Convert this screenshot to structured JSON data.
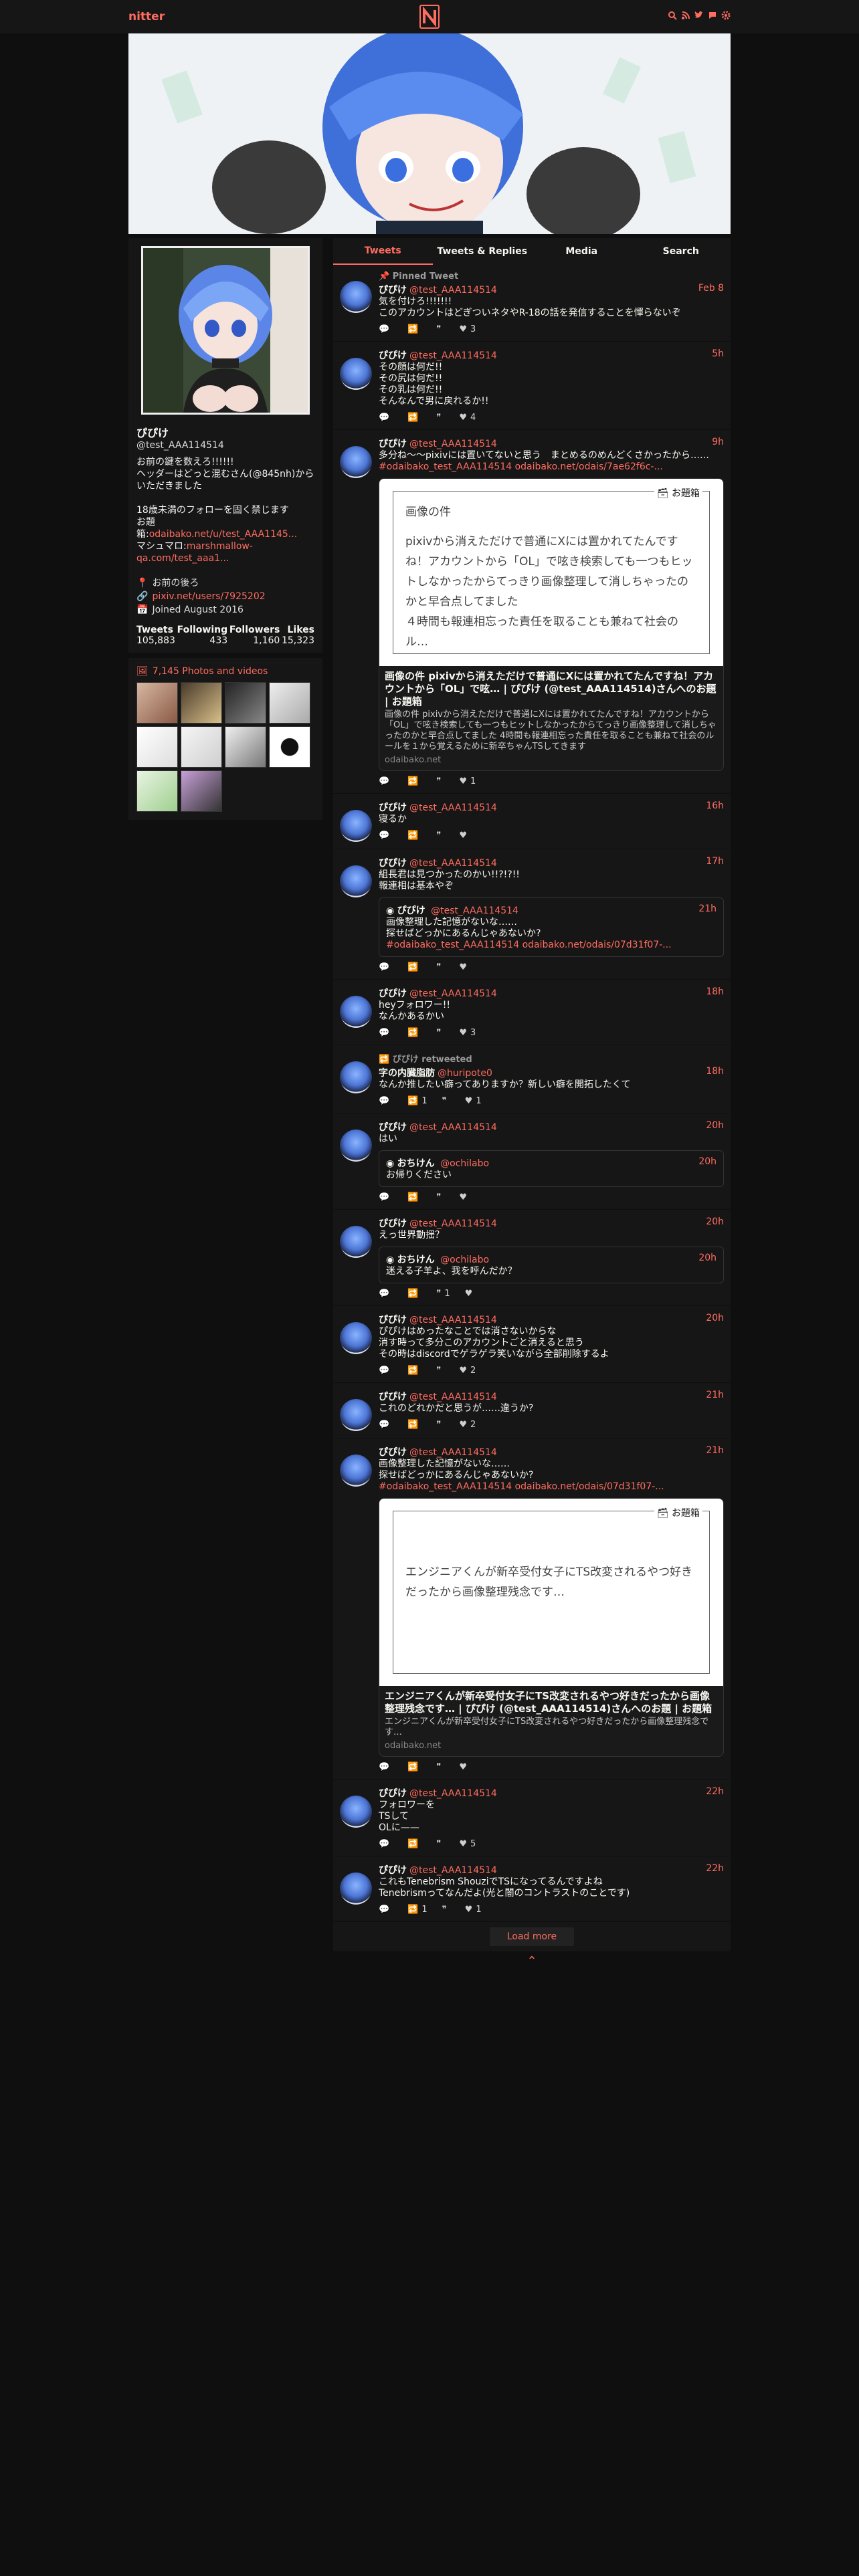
{
  "navbar": {
    "brand": "nitter",
    "logo": "N",
    "icons": [
      "search-icon",
      "rss-icon",
      "twitter-icon",
      "tweet-icon",
      "settings-icon"
    ]
  },
  "profile": {
    "fullname": "ぴぴけ",
    "username": "@test_AAA114514",
    "bio_lines": [
      "お前の鍵を数えろ!!!!!!",
      "ヘッダーはどっと混むさん(@845nh)からいただきました"
    ],
    "bio_2_line1": "18歳未満のフォローを固く禁じます",
    "bio_2_line2": "お題箱:",
    "bio_2_link": "odaibako.net/u/test_AAA1145...",
    "bio_2_line3": "マシュマロ:",
    "bio_2_link2": "marshmallow-qa.com/test_aaa1...",
    "location": "お前の後ろ",
    "website": "pixiv.net/users/7925202",
    "joined": "Joined August 2016",
    "stats": [
      {
        "label": "Tweets",
        "value": "105,883"
      },
      {
        "label": "Following",
        "value": "433"
      },
      {
        "label": "Followers",
        "value": "1,160"
      },
      {
        "label": "Likes",
        "value": "15,323"
      }
    ]
  },
  "media": {
    "header": "7,145 Photos and videos"
  },
  "tabs": [
    {
      "label": "Tweets",
      "active": true
    },
    {
      "label": "Tweets & Replies",
      "active": false
    },
    {
      "label": "Media",
      "active": false
    },
    {
      "label": "Search",
      "active": false
    }
  ],
  "tweets": [
    {
      "pinned": "Pinned Tweet",
      "name": "ぴぴけ",
      "handle": "@test_AAA114514",
      "date": "Feb 8",
      "text": "気を付けろ!!!!!!!\nこのアカウントはどぎついネタやR-18の話を発信することを憚らないぞ",
      "replies": "",
      "retweets": "",
      "quotes": "",
      "likes": "3"
    },
    {
      "name": "ぴぴけ",
      "handle": "@test_AAA114514",
      "date": "5h",
      "text": "その顔は何だ!!\nその尻は何だ!!\nその乳は何だ!!\nそんなんで男に戻れるか!!",
      "likes": "4"
    },
    {
      "name": "ぴぴけ",
      "handle": "@test_AAA114514",
      "date": "9h",
      "text": "多分ね〜〜pixivには置いてないと思う　まとめるのめんどくさかったから……",
      "link": "#odaibako_test_AAA114514 odaibako.net/odais/7ae62f6c-...",
      "card": {
        "badge": "お題箱",
        "img_title": "画像の件",
        "img_text": "pixivから消えただけで普通にXには置かれてたんですね！アカウントから「OL」で呟き検索しても一つもヒットしなかったからてっきり画像整理して消しちゃったのかと早合点してました\n４時間も報連相忘った責任を取ることも兼ねて社会のル…",
        "title": "画像の件 pixivから消えただけで普通にXには置かれてたんですね！アカウントから「OL」で呟… | ぴぴけ (@test_AAA114514)さんへのお題 | お題箱",
        "desc": "画像の件 pixivから消えただけで普通にXには置かれてたんですね！アカウントから「OL」で呟き検索しても一つもヒットしなかったからてっきり画像整理して消しちゃったのかと早合点してました 4時間も報連相忘った責任を取ることも兼ねて社会のルールを１から覚えるために新卒ちゃんTSしてきます",
        "dest": "odaibako.net"
      },
      "likes": "1"
    },
    {
      "name": "ぴぴけ",
      "handle": "@test_AAA114514",
      "date": "16h",
      "text": "寝るか"
    },
    {
      "name": "ぴぴけ",
      "handle": "@test_AAA114514",
      "date": "17h",
      "text": "組長君は見つかったのかい!!?!?!!\n報連相は基本やぞ",
      "quote": {
        "name": "ぴぴけ",
        "handle": "@test_AAA114514",
        "date": "21h",
        "text": "画像整理した記憶がないな……\n探せばどっかにあるんじゃあないか?",
        "link": "#odaibako_test_AAA114514 odaibako.net/odais/07d31f07-..."
      }
    },
    {
      "name": "ぴぴけ",
      "handle": "@test_AAA114514",
      "date": "18h",
      "text": "heyフォロワー!!\nなんかあるかい",
      "likes": "3"
    },
    {
      "retweeted_by": "ぴぴけ retweeted",
      "name": "字の内臓脂肪",
      "handle": "@huripote0",
      "date": "18h",
      "text": "なんか推したい癖ってありますか？新しい癖を開拓したくて",
      "retweets": "1",
      "likes": "1"
    },
    {
      "name": "ぴぴけ",
      "handle": "@test_AAA114514",
      "date": "20h",
      "text": "はい",
      "quote": {
        "name": "おちけん",
        "handle": "@ochilabo",
        "date": "20h",
        "text": "お帰りください"
      }
    },
    {
      "name": "ぴぴけ",
      "handle": "@test_AAA114514",
      "date": "20h",
      "text": "えっ世界動揺？",
      "quote": {
        "name": "おちけん",
        "handle": "@ochilabo",
        "date": "20h",
        "text": "迷える子羊よ、我を呼んだか？"
      },
      "quotes": "1"
    },
    {
      "name": "ぴぴけ",
      "handle": "@test_AAA114514",
      "date": "20h",
      "text": "ぴぴけはめったなことでは消さないからな\n消す時って多分このアカウントごと消えると思う\nその時はdiscordでゲラゲラ笑いながら全部削除するよ",
      "likes": "2"
    },
    {
      "name": "ぴぴけ",
      "handle": "@test_AAA114514",
      "date": "21h",
      "text": "これのどれかだと思うが……違うか?",
      "likes": "2"
    },
    {
      "name": "ぴぴけ",
      "handle": "@test_AAA114514",
      "date": "21h",
      "text": "画像整理した記憶がないな……\n探せばどっかにあるんじゃあないか?",
      "link": "#odaibako_test_AAA114514 odaibako.net/odais/07d31f07-...",
      "card": {
        "badge": "お題箱",
        "img_title": "",
        "img_text": "エンジニアくんが新卒受付女子にTS改変されるやつ好きだったから画像整理残念です…",
        "title": "エンジニアくんが新卒受付女子にTS改変されるやつ好きだったから画像整理残念です… | ぴぴけ (@test_AAA114514)さんへのお題 | お題箱",
        "desc": "エンジニアくんが新卒受付女子にTS改変されるやつ好きだったから画像整理残念です…",
        "dest": "odaibako.net"
      }
    },
    {
      "name": "ぴぴけ",
      "handle": "@test_AAA114514",
      "date": "22h",
      "text": "フォロワーを\nTSして\nOLに——",
      "likes": "5"
    },
    {
      "name": "ぴぴけ",
      "handle": "@test_AAA114514",
      "date": "22h",
      "text": "これもTenebrism ShouziでTSになってるんですよね\nTenebrismってなんだよ(光と闇のコントラストのことです)",
      "retweets": "1",
      "likes": "1"
    }
  ],
  "load_more": "Load more",
  "accent_color": "#ff6c60"
}
